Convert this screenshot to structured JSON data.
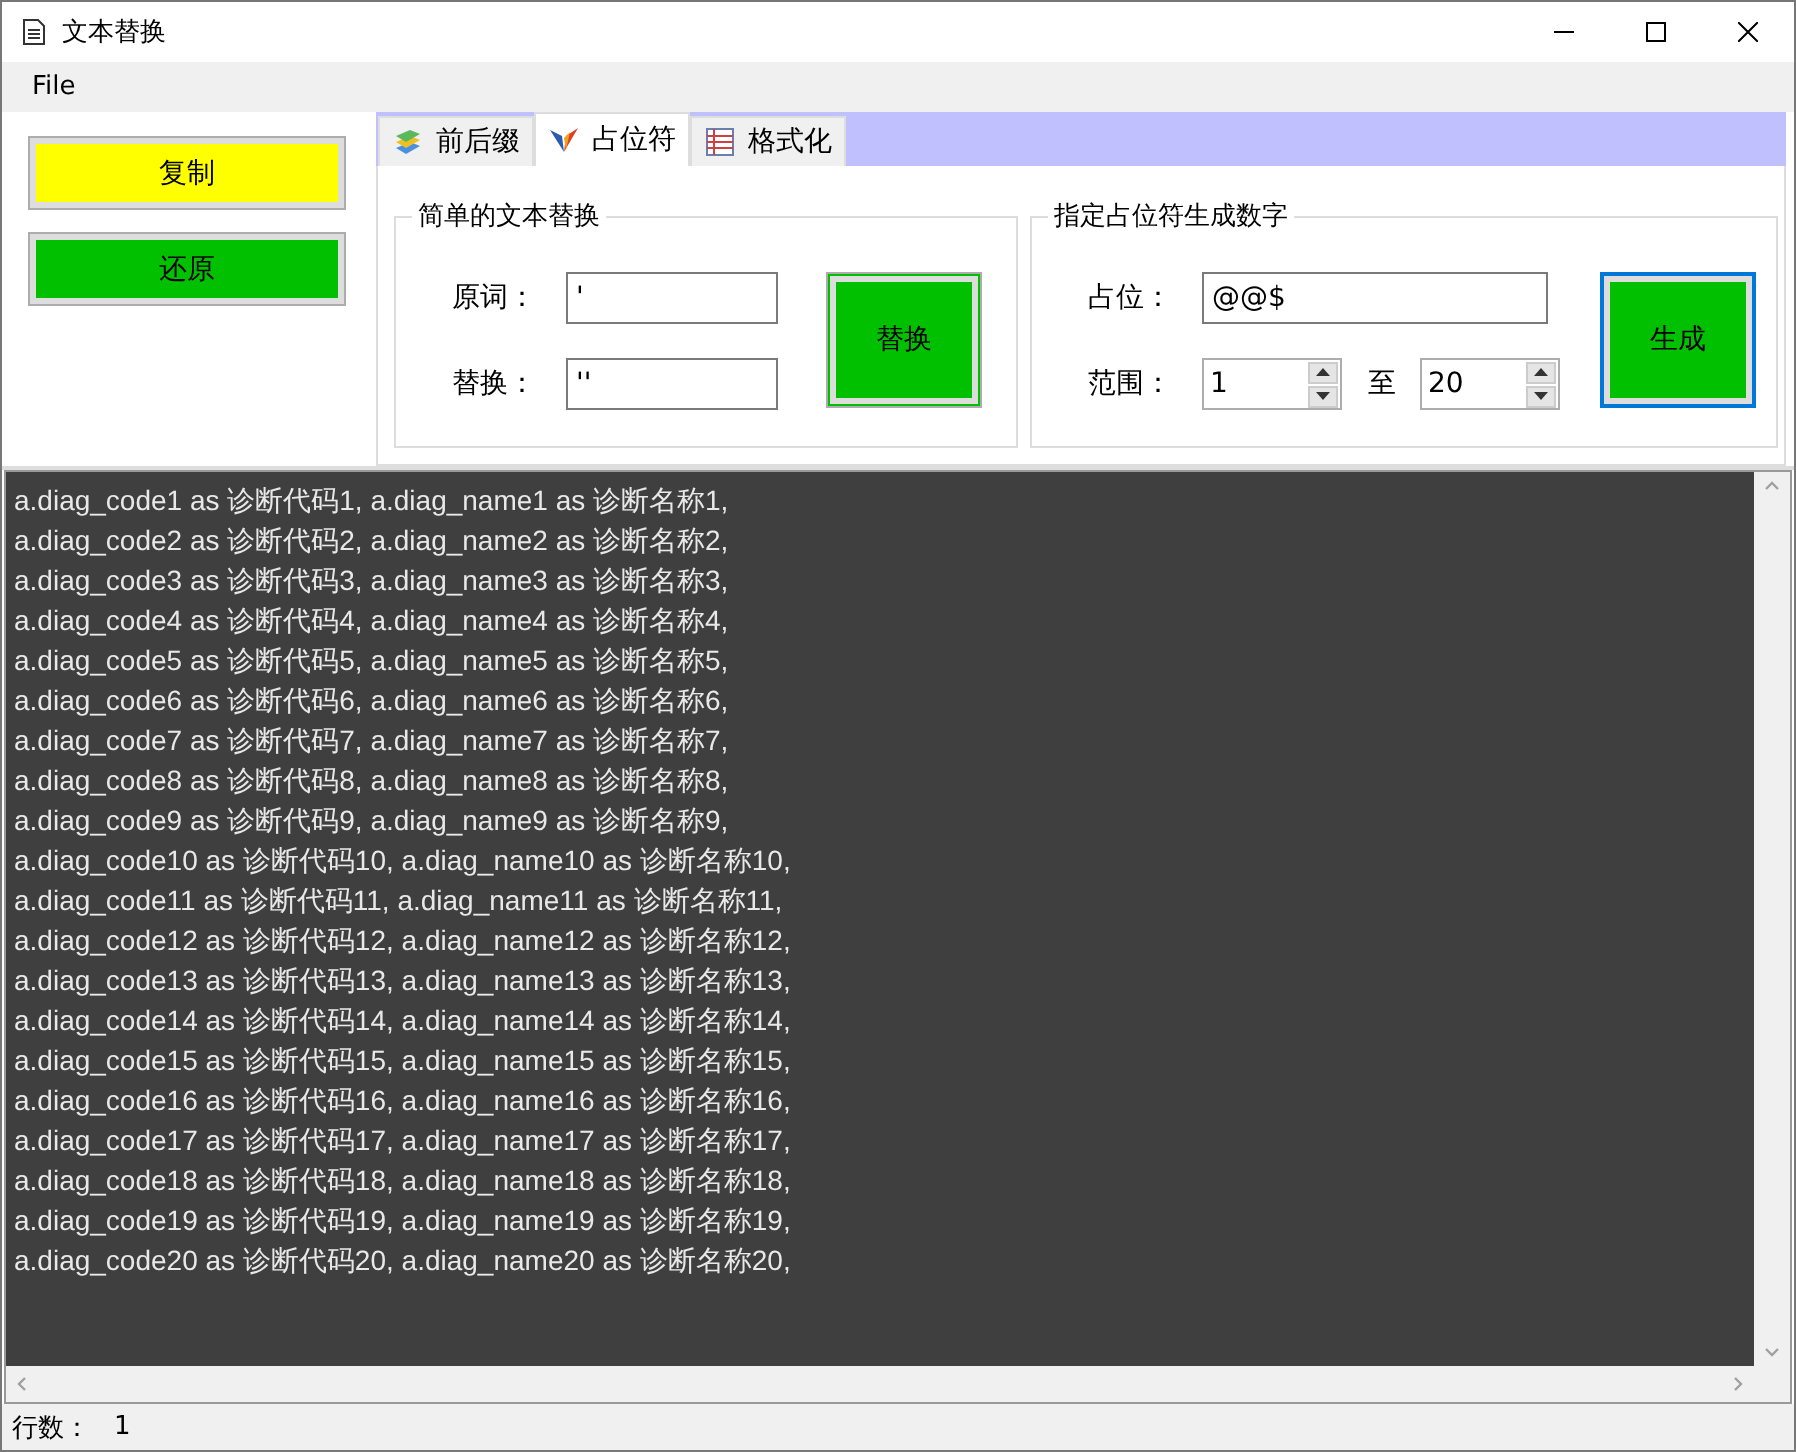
{
  "window": {
    "title": "文本替换"
  },
  "menu": [
    "File"
  ],
  "side_buttons": [
    {
      "label": "复制",
      "color": "#ffff00"
    },
    {
      "label": "还原",
      "color": "#00c000"
    }
  ],
  "tabs": [
    {
      "label": "前后缀",
      "selected": false,
      "kind": "layers"
    },
    {
      "label": "占位符",
      "selected": true,
      "kind": "wings"
    },
    {
      "label": "格式化",
      "selected": false,
      "kind": "sheet"
    }
  ],
  "replace_group": {
    "title": "简单的文本替换",
    "fields": [
      {
        "label": "原词：",
        "value": "'"
      },
      {
        "label": "替换：",
        "value": "''"
      }
    ],
    "button": {
      "label": "替换",
      "focused": false
    }
  },
  "generate_group": {
    "title": "指定占位符生成数字",
    "placeholder_field": {
      "label": "占位：",
      "value": "@@$"
    },
    "range": {
      "label": "范围：",
      "from": "1",
      "separator": "至",
      "to": "20"
    },
    "button": {
      "label": "生成",
      "focused": true
    }
  },
  "editor_lines": [
    "a.diag_code1 as 诊断代码1, a.diag_name1 as 诊断名称1,",
    "a.diag_code2 as 诊断代码2, a.diag_name2 as 诊断名称2,",
    "a.diag_code3 as 诊断代码3, a.diag_name3 as 诊断名称3,",
    "a.diag_code4 as 诊断代码4, a.diag_name4 as 诊断名称4,",
    "a.diag_code5 as 诊断代码5, a.diag_name5 as 诊断名称5,",
    "a.diag_code6 as 诊断代码6, a.diag_name6 as 诊断名称6,",
    "a.diag_code7 as 诊断代码7, a.diag_name7 as 诊断名称7,",
    "a.diag_code8 as 诊断代码8, a.diag_name8 as 诊断名称8,",
    "a.diag_code9 as 诊断代码9, a.diag_name9 as 诊断名称9,",
    "a.diag_code10 as 诊断代码10, a.diag_name10 as 诊断名称10,",
    "a.diag_code11 as 诊断代码11, a.diag_name11 as 诊断名称11,",
    "a.diag_code12 as 诊断代码12, a.diag_name12 as 诊断名称12,",
    "a.diag_code13 as 诊断代码13, a.diag_name13 as 诊断名称13,",
    "a.diag_code14 as 诊断代码14, a.diag_name14 as 诊断名称14,",
    "a.diag_code15 as 诊断代码15, a.diag_name15 as 诊断名称15,",
    "a.diag_code16 as 诊断代码16, a.diag_name16 as 诊断名称16,",
    "a.diag_code17 as 诊断代码17, a.diag_name17 as 诊断名称17,",
    "a.diag_code18 as 诊断代码18, a.diag_name18 as 诊断名称18,",
    "a.diag_code19 as 诊断代码19, a.diag_name19 as 诊断名称19,",
    "a.diag_code20 as 诊断代码20, a.diag_name20 as 诊断名称20,"
  ],
  "status_bar": {
    "label": "行数：",
    "value": "1"
  }
}
